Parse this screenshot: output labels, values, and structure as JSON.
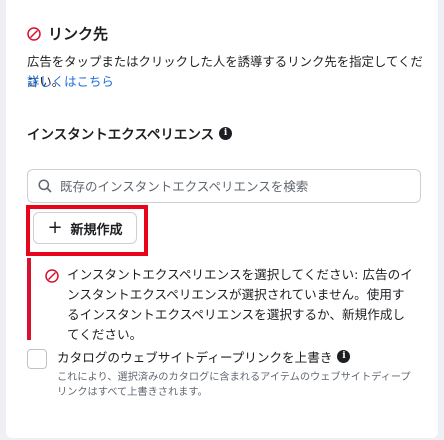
{
  "header": {
    "title": "リンク先"
  },
  "description": "広告をタップまたはクリックした人を誘導するリンク先を指定してください。",
  "learn_more": "詳しくはこちら",
  "instant_experience": {
    "title": "インスタントエクスペリエンス",
    "search_placeholder": "既存のインスタントエクスペリエンスを検索",
    "new_button": "新規作成",
    "error_message": "インスタントエクスペリエンスを選択してください: 広告のインスタントエクスペリエンスが選択されていません。使用するインスタントエクスペリエンスを選択するか、新規作成してください。"
  },
  "catalog_override": {
    "label": "カタログのウェブサイトディープリンクを上書き",
    "description": "これにより、選択済みのカタログに含まれるアイテムのウェブサイトディープリンクはすべて上書きされます。",
    "checked": false
  },
  "colors": {
    "error": "#d8112f",
    "highlight": "#e8051b",
    "link": "#216fdb"
  }
}
